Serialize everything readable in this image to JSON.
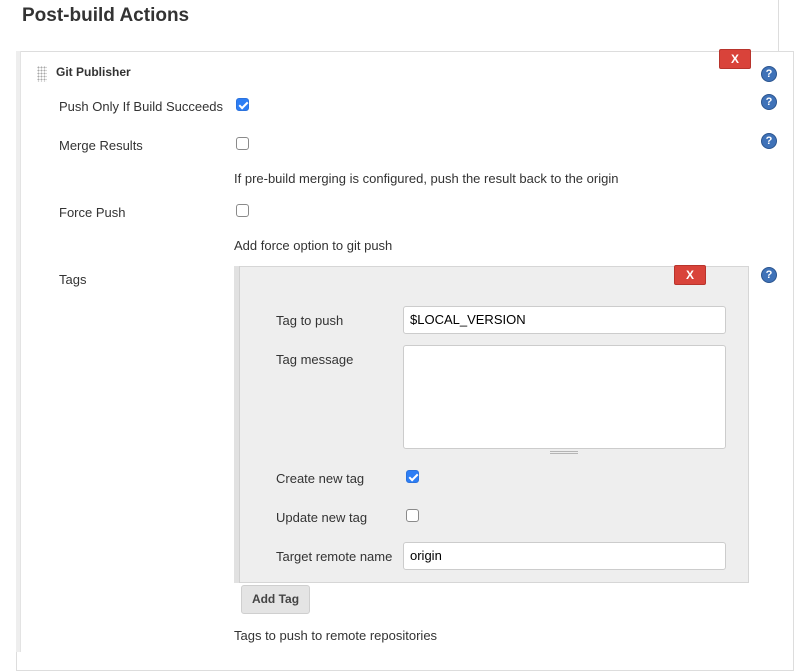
{
  "section": {
    "title": "Post-build Actions"
  },
  "publisher": {
    "title": "Git Publisher",
    "delete_label": "X",
    "help_label": "?"
  },
  "fields": {
    "push_only_if_build_succeeds": {
      "label": "Push Only If Build Succeeds",
      "checked": true
    },
    "merge_results": {
      "label": "Merge Results",
      "checked": false,
      "description": "If pre-build merging is configured, push the result back to the origin"
    },
    "force_push": {
      "label": "Force Push",
      "checked": false,
      "description": "Add force option to git push"
    },
    "tags": {
      "label": "Tags",
      "description": "Tags to push to remote repositories"
    }
  },
  "tag": {
    "delete_label": "X",
    "tag_to_push": {
      "label": "Tag to push",
      "value": "$LOCAL_VERSION"
    },
    "tag_message": {
      "label": "Tag message",
      "value": ""
    },
    "create_new_tag": {
      "label": "Create new tag",
      "checked": true
    },
    "update_new_tag": {
      "label": "Update new tag",
      "checked": false
    },
    "target_remote_name": {
      "label": "Target remote name",
      "value": "origin"
    }
  },
  "add_tag_label": "Add Tag",
  "colors": {
    "delete_button": "#d9433a",
    "help_icon": "#3f72b8",
    "checkbox_checked": "#2d7ef5",
    "tag_panel_bg": "#eeeeee"
  }
}
